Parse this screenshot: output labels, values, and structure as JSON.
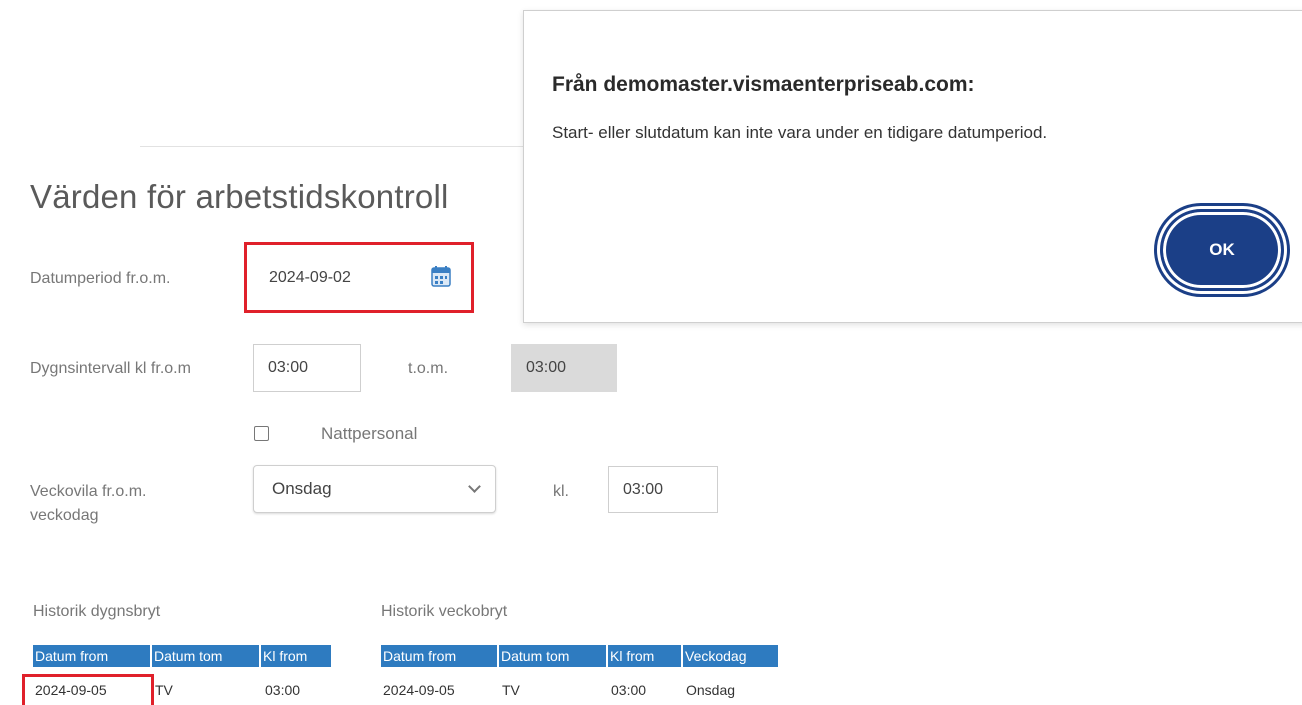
{
  "page": {
    "title": "Värden för arbetstidskontroll"
  },
  "form": {
    "datumperiod_label": "Datumperiod fr.o.m.",
    "datumperiod_value": "2024-09-02",
    "dygnsintervall_label": "Dygnsintervall kl fr.o.m",
    "dygns_from_value": "03:00",
    "tom_label": "t.o.m.",
    "dygns_tom_value": "03:00",
    "nattpersonal_label": "Nattpersonal",
    "nattpersonal_checked": false,
    "veckovila_label": "Veckovila fr.o.m. veckodag",
    "veckovila_day": "Onsdag",
    "kl_label": "kl.",
    "veckovila_time": "03:00"
  },
  "history_dygn": {
    "title": "Historik dygnsbryt",
    "columns": [
      "Datum from",
      "Datum tom",
      "Kl from"
    ],
    "rows": [
      [
        "2024-09-05",
        "TV",
        "03:00"
      ]
    ]
  },
  "history_vecko": {
    "title": "Historik veckobryt",
    "columns": [
      "Datum from",
      "Datum tom",
      "Kl from",
      "Veckodag"
    ],
    "rows": [
      [
        "2024-09-05",
        "TV",
        "03:00",
        "Onsdag"
      ]
    ]
  },
  "dialog": {
    "title": "Från demomaster.vismaenterpriseab.com:",
    "message": "Start- eller slutdatum kan inte vara under en tidigare datumperiod.",
    "ok_label": "OK"
  },
  "colors": {
    "highlight": "#e0202a",
    "table_header": "#2e7bc0",
    "ok_button": "#1b3f87"
  },
  "icons": {
    "date_picker": "calendar-icon",
    "select_arrow": "chevron-down-icon"
  }
}
